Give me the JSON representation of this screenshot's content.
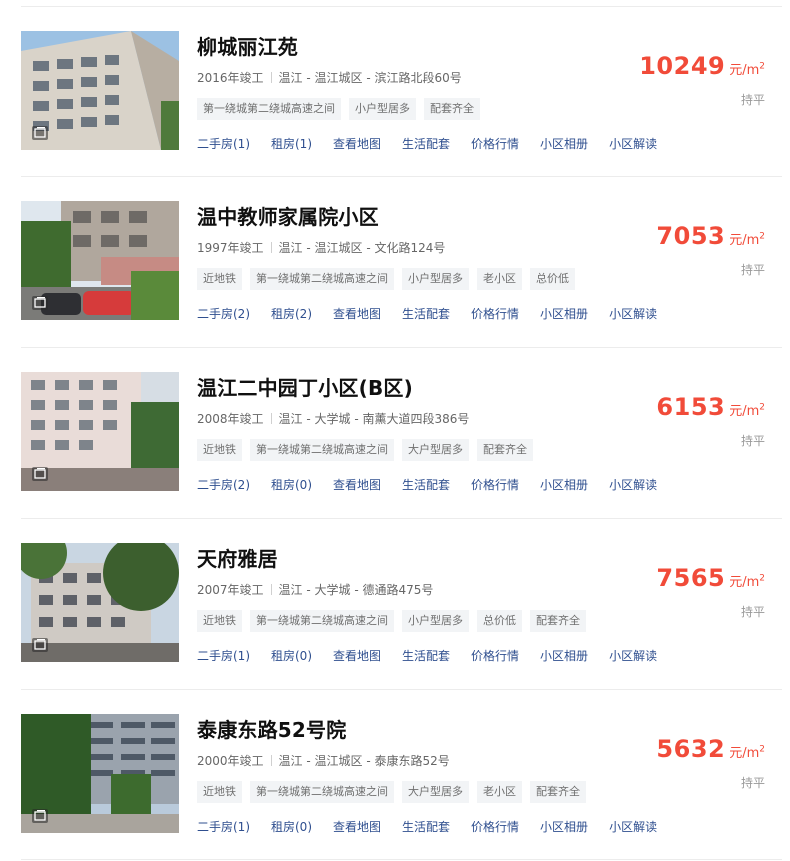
{
  "listings": [
    {
      "name": "柳城丽江苑",
      "year": "2016年竣工",
      "location": "温江 - 温江城区 - 滨江路北段60号",
      "tags": [
        "第一绕城第二绕城高速之间",
        "小户型居多",
        "配套齐全"
      ],
      "links": [
        "二手房(1)",
        "租房(1)",
        "查看地图",
        "生活配套",
        "价格行情",
        "小区相册",
        "小区解读"
      ],
      "price": "10249",
      "unit": "元/m",
      "unit_sup": "2",
      "trend": "持平"
    },
    {
      "name": "温中教师家属院小区",
      "year": "1997年竣工",
      "location": "温江 - 温江城区 - 文化路124号",
      "tags": [
        "近地铁",
        "第一绕城第二绕城高速之间",
        "小户型居多",
        "老小区",
        "总价低"
      ],
      "links": [
        "二手房(2)",
        "租房(2)",
        "查看地图",
        "生活配套",
        "价格行情",
        "小区相册",
        "小区解读"
      ],
      "price": "7053",
      "unit": "元/m",
      "unit_sup": "2",
      "trend": "持平"
    },
    {
      "name": "温江二中园丁小区(B区)",
      "year": "2008年竣工",
      "location": "温江 - 大学城 - 南薰大道四段386号",
      "tags": [
        "近地铁",
        "第一绕城第二绕城高速之间",
        "大户型居多",
        "配套齐全"
      ],
      "links": [
        "二手房(2)",
        "租房(0)",
        "查看地图",
        "生活配套",
        "价格行情",
        "小区相册",
        "小区解读"
      ],
      "price": "6153",
      "unit": "元/m",
      "unit_sup": "2",
      "trend": "持平"
    },
    {
      "name": "天府雅居",
      "year": "2007年竣工",
      "location": "温江 - 大学城 - 德通路475号",
      "tags": [
        "近地铁",
        "第一绕城第二绕城高速之间",
        "小户型居多",
        "总价低",
        "配套齐全"
      ],
      "links": [
        "二手房(1)",
        "租房(0)",
        "查看地图",
        "生活配套",
        "价格行情",
        "小区相册",
        "小区解读"
      ],
      "price": "7565",
      "unit": "元/m",
      "unit_sup": "2",
      "trend": "持平"
    },
    {
      "name": "泰康东路52号院",
      "year": "2000年竣工",
      "location": "温江 - 温江城区 - 泰康东路52号",
      "tags": [
        "近地铁",
        "第一绕城第二绕城高速之间",
        "大户型居多",
        "老小区",
        "配套齐全"
      ],
      "links": [
        "二手房(1)",
        "租房(0)",
        "查看地图",
        "生活配套",
        "价格行情",
        "小区相册",
        "小区解读"
      ],
      "price": "5632",
      "unit": "元/m",
      "unit_sup": "2",
      "trend": "持平"
    }
  ],
  "colors": {
    "price": "#f14b39",
    "link": "#2f4f8f",
    "tag_bg": "#f2f4f6"
  }
}
